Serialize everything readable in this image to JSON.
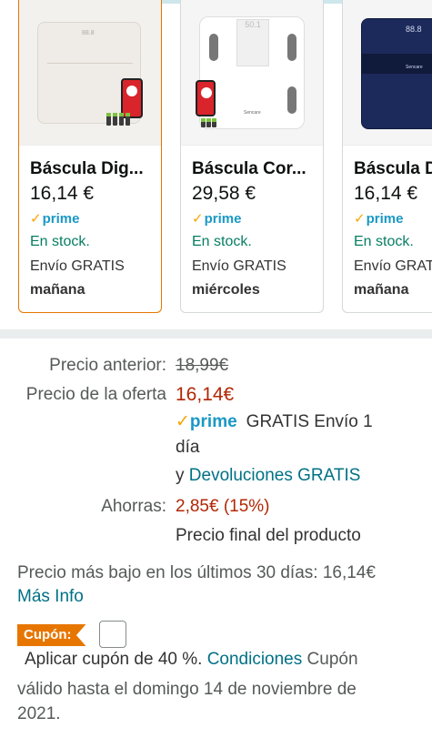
{
  "carousel": {
    "cards": [
      {
        "title": "Báscula Dig...",
        "price": "16,14 €",
        "prime": "prime",
        "stock": "En stock.",
        "shipping": "Envío GRATIS",
        "ship_date": "mañana",
        "display_text": "88.8"
      },
      {
        "title": "Báscula Cor...",
        "price": "29,58 €",
        "prime": "prime",
        "stock": "En stock.",
        "shipping": "Envío GRATIS",
        "ship_date": "miércoles",
        "display_text": "50.1",
        "brand": "Sencare"
      },
      {
        "title": "Báscula D",
        "price": "16,14 €",
        "prime": "prime",
        "stock": "En stock.",
        "shipping": "Envío GRAT",
        "ship_date": "mañana",
        "display_text": "88.8",
        "brand": "Sencare"
      }
    ]
  },
  "pricing": {
    "previous_label": "Precio anterior:",
    "previous_value": "18,99€",
    "deal_label": "Precio de la oferta",
    "deal_value": "16,14€",
    "prime": "prime",
    "delivery_line1": "GRATIS Envío 1",
    "delivery_line2": "día",
    "returns_prefix": "y",
    "returns_link": "Devoluciones GRATIS",
    "savings_label": "Ahorras:",
    "savings_value": "2,85€ (15%)",
    "final_note": "Precio final del producto"
  },
  "lowest_price": {
    "text": "Precio más bajo en los últimos 30 días: 16,14€",
    "more_info": "Más Info"
  },
  "coupon": {
    "badge": "Cupón:",
    "apply_text": "Aplicar cupón de 40 %.",
    "conditions_link": "Condiciones",
    "validity_line1_suffix": "Cupón",
    "validity_line2": "válido hasta el domingo 14 de noviembre de",
    "validity_line3": "2021."
  },
  "colors": {
    "accent": "#e77600",
    "price_red": "#b12704",
    "link": "#007185",
    "stock_green": "#067d62",
    "prime_blue": "#1a98c5"
  }
}
